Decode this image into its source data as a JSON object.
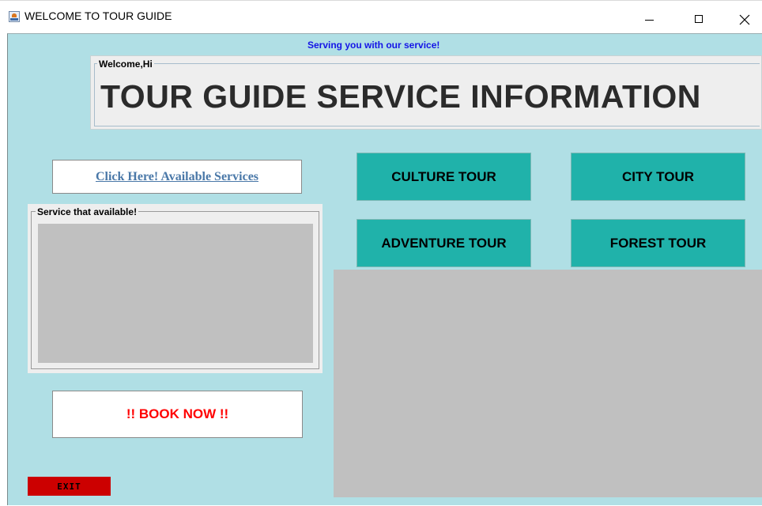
{
  "window": {
    "title": "WELCOME TO TOUR GUIDE",
    "icon": "java-cup-icon",
    "controls": [
      "minimize-icon",
      "maximize-icon",
      "close-icon"
    ]
  },
  "header": {
    "tagline": "Serving you with our service!",
    "welcome_label": "Welcome,Hi",
    "title": "TOUR GUIDE SERVICE INFORMATION"
  },
  "services": {
    "available_button": "Click Here! Available Services",
    "panel_title": "Service that available!"
  },
  "tours": {
    "culture": "CULTURE TOUR",
    "city": "CITY TOUR",
    "adventure": "ADVENTURE TOUR",
    "forest": "FOREST TOUR"
  },
  "actions": {
    "book": "!! BOOK NOW !!",
    "exit": "EXIT"
  },
  "colors": {
    "background": "#b0dfe5",
    "tour_button": "#20b2aa",
    "exit_button": "#cc0000",
    "book_text": "#ff0000",
    "tagline_text": "#1414e6",
    "placeholder_area": "#c0c0c0"
  }
}
